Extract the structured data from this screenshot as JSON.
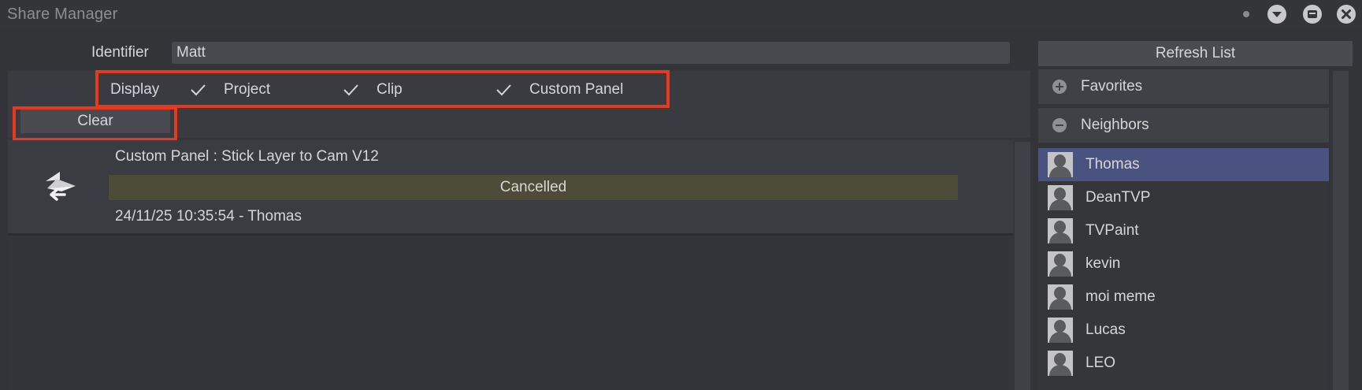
{
  "window": {
    "title": "Share Manager",
    "controls": [
      "dot-icon",
      "minimize-icon",
      "collapse-icon",
      "close-icon"
    ]
  },
  "identifier": {
    "label": "Identifier",
    "value": "Matt"
  },
  "display": {
    "label": "Display",
    "options": [
      {
        "label": "Project",
        "checked": true
      },
      {
        "label": "Clip",
        "checked": true
      },
      {
        "label": "Custom Panel",
        "checked": true
      }
    ]
  },
  "clear_button": "Clear",
  "log": {
    "items": [
      {
        "icon": "share-transfer-icon",
        "title": "Custom Panel : Stick Layer to Cam V12",
        "status": "Cancelled",
        "meta": "24/11/25 10:35:54 - Thomas"
      }
    ]
  },
  "right_panel": {
    "refresh_label": "Refresh List",
    "sections": [
      {
        "label": "Favorites",
        "icon": "plus-circle-icon",
        "expanded": false
      },
      {
        "label": "Neighbors",
        "icon": "minus-circle-icon",
        "expanded": true
      }
    ],
    "users": [
      {
        "name": "Thomas",
        "selected": true
      },
      {
        "name": "DeanTVP",
        "selected": false
      },
      {
        "name": "TVPaint",
        "selected": false
      },
      {
        "name": "kevin",
        "selected": false
      },
      {
        "name": "moi meme",
        "selected": false
      },
      {
        "name": "Lucas",
        "selected": false
      },
      {
        "name": "LEO",
        "selected": false
      }
    ]
  },
  "colors": {
    "background": "#333438",
    "highlight_box": "#e8381e",
    "selected_row": "#4a5380",
    "status_cancelled": "#4c4c38"
  }
}
